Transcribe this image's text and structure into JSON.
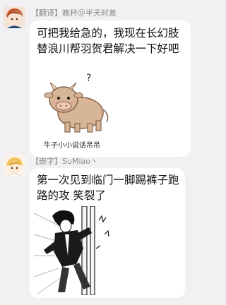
{
  "messages": [
    {
      "sender": "【翻译】晚杯＠半天时差",
      "lines": [
        "可把我给急的，我现在长幻肢",
        "替浪川帮羽贺君解决一下好吧"
      ],
      "sticker": {
        "icon": "cartoon-cow-icon",
        "caption": "牛子小小说话吊吊",
        "question_mark": "?"
      }
    },
    {
      "sender": "【嵌字】SuMiao丶",
      "lines": [
        "第一次见到临门一脚踢裤子跑",
        "路的攻 笑裂了"
      ],
      "sticker": {
        "icon": "manga-panel-image"
      }
    }
  ],
  "colors": {
    "background": "#f1f1f3",
    "bubble": "#ffffff",
    "sender": "#8a8a8a"
  }
}
